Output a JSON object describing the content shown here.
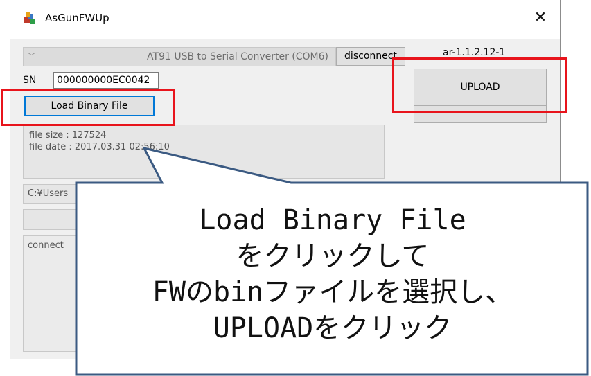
{
  "window": {
    "title": "AsGunFWUp",
    "close_glyph": "✕",
    "app_icon": "app-icon"
  },
  "device": {
    "combo_value": "AT91 USB to Serial Converter (COM6)",
    "combo_chevron": "﹀",
    "disconnect_label": "disconnect",
    "version": "ar-1.1.2.12-1"
  },
  "serial": {
    "label": "SN",
    "value": "000000000EC0042"
  },
  "actions": {
    "load_label": "Load Binary File",
    "upload_label": "UPLOAD"
  },
  "file_info": {
    "size_line": "file size : 127524",
    "date_line": "file date : 2017.03.31 02:56:10"
  },
  "path_text": "C:¥Users",
  "log_text": "connect",
  "callout": {
    "lines": [
      "Load Binary File",
      "をクリックして",
      "FWのbinファイルを選択し、",
      "UPLOADをクリック"
    ]
  },
  "colors": {
    "highlight": "#e8141c",
    "callout_border": "#3b5a82",
    "focus": "#0078d7"
  }
}
